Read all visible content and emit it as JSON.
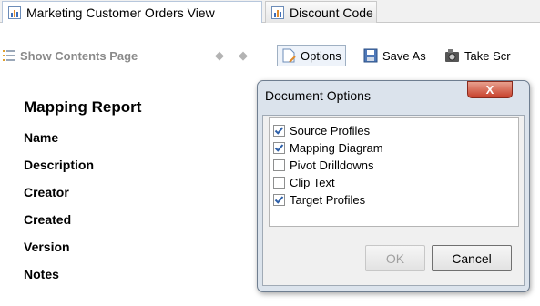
{
  "tabs": [
    {
      "label": "Marketing Customer Orders View",
      "icon": "report-icon"
    },
    {
      "label": "Discount Code",
      "icon": "report-icon"
    }
  ],
  "toolbar": {
    "show_contents": "Show Contents Page",
    "options": "Options",
    "save_as": "Save As",
    "take": "Take Scr"
  },
  "report": {
    "title": "Mapping Report",
    "fields": [
      "Name",
      "Description",
      "Creator",
      "Created",
      "Version",
      "Notes"
    ]
  },
  "dialog": {
    "title": "Document Options",
    "close": "X",
    "options": [
      {
        "label": "Source Profiles",
        "checked": true
      },
      {
        "label": "Mapping Diagram",
        "checked": true
      },
      {
        "label": "Pivot Drilldowns",
        "checked": false
      },
      {
        "label": "Clip Text",
        "checked": false
      },
      {
        "label": "Target Profiles",
        "checked": true
      }
    ],
    "ok": "OK",
    "cancel": "Cancel"
  },
  "colors": {
    "accent": "#3d6eb8",
    "close_red": "#c7402b",
    "dialog_frame": "#dbe3ec"
  }
}
